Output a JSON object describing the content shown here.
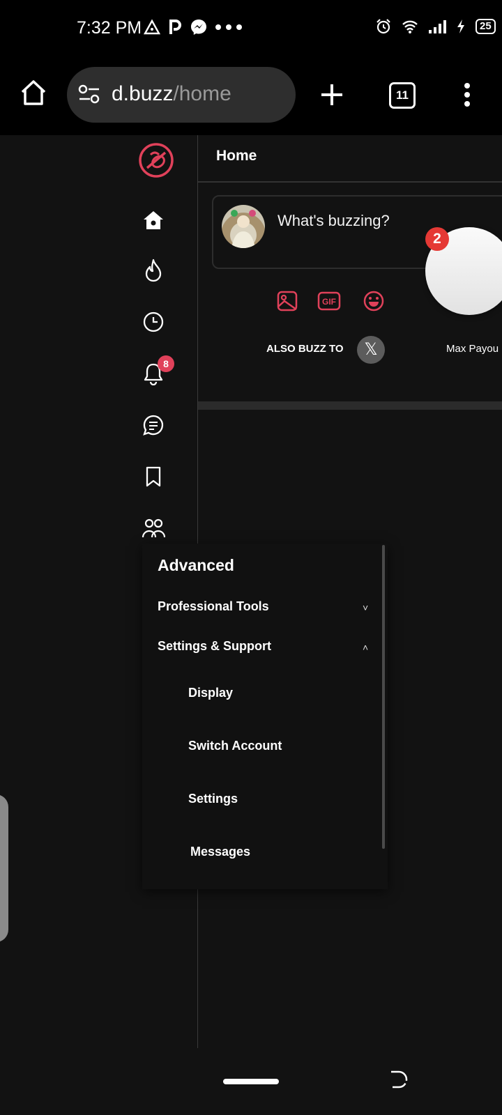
{
  "status_bar": {
    "time": "7:32 PM",
    "battery": "25"
  },
  "browser": {
    "url_domain": "d.buzz",
    "url_path": "/home",
    "tab_count": "11"
  },
  "sidebar": {
    "notifications_badge": "8"
  },
  "header": {
    "title": "Home"
  },
  "composer": {
    "placeholder": "What's buzzing?",
    "gif_label": "GIF",
    "also_buzz_label": "ALSO BUZZ TO",
    "x_glyph": "𝕏",
    "max_payout_label": "Max Payou"
  },
  "floating": {
    "badge": "2"
  },
  "advanced_menu": {
    "title": "Advanced",
    "sections": [
      {
        "label": "Professional Tools",
        "chevron": "˅"
      },
      {
        "label": "Settings & Support",
        "chevron": "˄"
      }
    ],
    "items": [
      {
        "label": "Display"
      },
      {
        "label": "Switch Account"
      },
      {
        "label": "Settings"
      },
      {
        "label": "Messages"
      }
    ]
  },
  "colors": {
    "accent": "#e0415a",
    "background": "#121212"
  }
}
